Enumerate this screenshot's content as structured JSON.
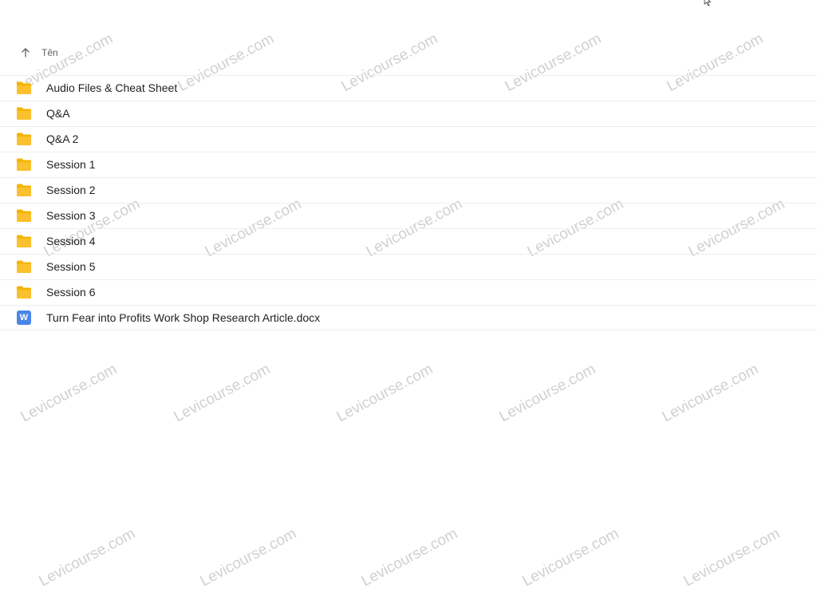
{
  "header": {
    "sort_column_label": "Tên"
  },
  "files": [
    {
      "name": "Audio Files & Cheat Sheet",
      "type": "folder",
      "icon": "folder-icon"
    },
    {
      "name": "Q&A",
      "type": "folder",
      "icon": "folder-icon"
    },
    {
      "name": "Q&A 2",
      "type": "folder",
      "icon": "folder-icon"
    },
    {
      "name": "Session 1",
      "type": "folder",
      "icon": "folder-icon"
    },
    {
      "name": "Session 2",
      "type": "folder",
      "icon": "folder-icon"
    },
    {
      "name": "Session 3",
      "type": "folder",
      "icon": "folder-icon"
    },
    {
      "name": "Session 4",
      "type": "folder",
      "icon": "folder-icon"
    },
    {
      "name": "Session 5",
      "type": "folder",
      "icon": "folder-icon"
    },
    {
      "name": "Session 6",
      "type": "folder",
      "icon": "folder-icon"
    },
    {
      "name": "Turn Fear into Profits Work Shop Research Article.docx",
      "type": "docx",
      "icon": "word-doc-icon",
      "icon_letter": "W"
    }
  ],
  "watermark": {
    "text": "Levicourse.com"
  },
  "colors": {
    "folder": "#f5b400",
    "word_doc": "#4a86e8",
    "divider": "#eceef1"
  }
}
